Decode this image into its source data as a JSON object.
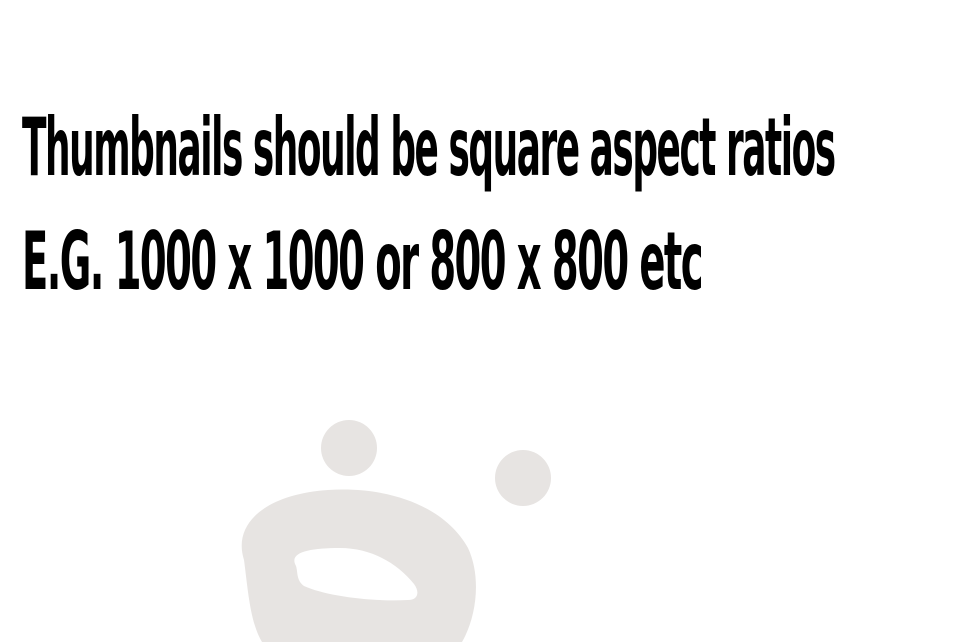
{
  "text": {
    "line_1": "Thumbnails should be square aspect ratios",
    "line_2": "E.G. 1000 x 1000 or 800 x 800 etc"
  },
  "colors": {
    "background": "#ffffff",
    "text": "#000000",
    "blob": "#e7e4e2"
  },
  "decoration": {
    "icon": "grey-blob-face-icon"
  }
}
